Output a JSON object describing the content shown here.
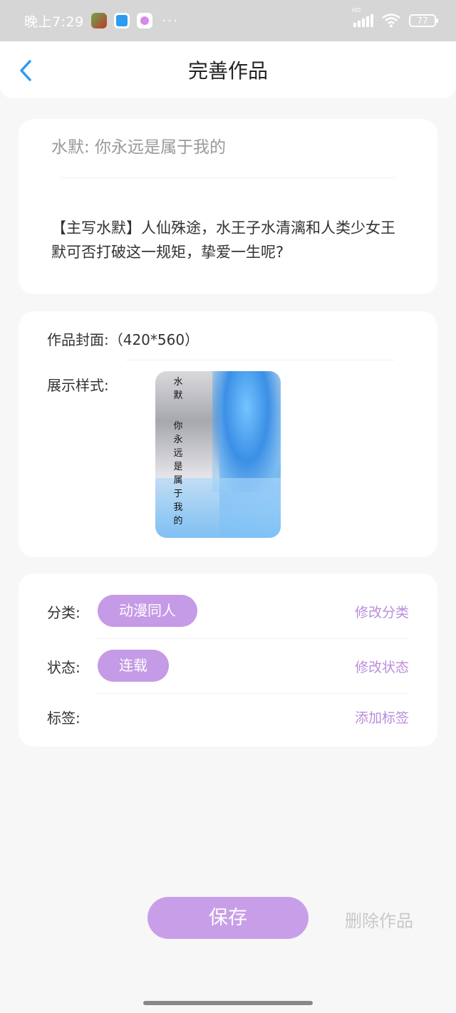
{
  "status_bar": {
    "time": "晚上7:29",
    "dots": "···",
    "signal_label": "HD",
    "battery": "77"
  },
  "header": {
    "title": "完善作品"
  },
  "work": {
    "title": "水默: 你永远是属于我的",
    "description": "【主写水默】人仙殊途，水王子水清漓和人类少女王默可否打破这一规矩，挚爱一生呢?"
  },
  "cover": {
    "label": "作品封面:（420*560）",
    "style_label": "展示样式:",
    "cover_text_top": "水默",
    "cover_text_bottom": "你永远是属于我的"
  },
  "meta": {
    "category_label": "分类:",
    "category_value": "动漫同人",
    "category_action": "修改分类",
    "status_label": "状态:",
    "status_value": "连载",
    "status_action": "修改状态",
    "tags_label": "标签:",
    "tags_action": "添加标签"
  },
  "actions": {
    "save": "保存",
    "delete": "删除作品"
  },
  "colors": {
    "accent": "#c59ae6",
    "accent_text": "#b98ddc",
    "back_arrow": "#2d9bf0",
    "background": "#f7f7f7"
  }
}
